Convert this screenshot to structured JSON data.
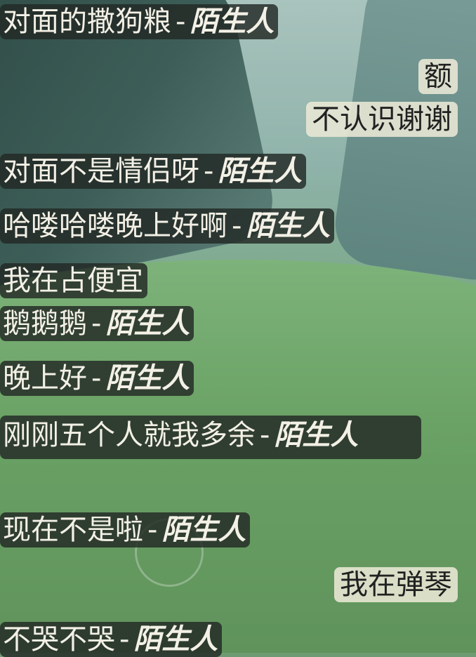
{
  "chat": {
    "messages": [
      {
        "kind": "other",
        "text": "对面的撒狗粮",
        "sep": "-",
        "author": "陌生人"
      },
      {
        "kind": "self",
        "text": "额"
      },
      {
        "kind": "self",
        "text": "不认识谢谢"
      },
      {
        "kind": "other",
        "text": "对面不是情侣呀",
        "sep": "-",
        "author": "陌生人"
      },
      {
        "kind": "other",
        "text": "哈喽哈喽晚上好啊",
        "sep": "-",
        "author": "陌生人"
      },
      {
        "kind": "other",
        "text": "我在占便宜"
      },
      {
        "kind": "other",
        "text": "鹅鹅鹅",
        "sep": "-",
        "author": "陌生人"
      },
      {
        "kind": "other",
        "text": "晚上好",
        "sep": "-",
        "author": "陌生人"
      },
      {
        "kind": "other",
        "text": "刚刚五个人就我多余",
        "sep": "-",
        "author": "陌生人"
      },
      {
        "kind": "other",
        "text": "现在不是啦",
        "sep": "-",
        "author": "陌生人"
      },
      {
        "kind": "self",
        "text": "我在弹琴"
      },
      {
        "kind": "other",
        "text": "不哭不哭",
        "sep": "-",
        "author": "陌生人"
      }
    ]
  }
}
